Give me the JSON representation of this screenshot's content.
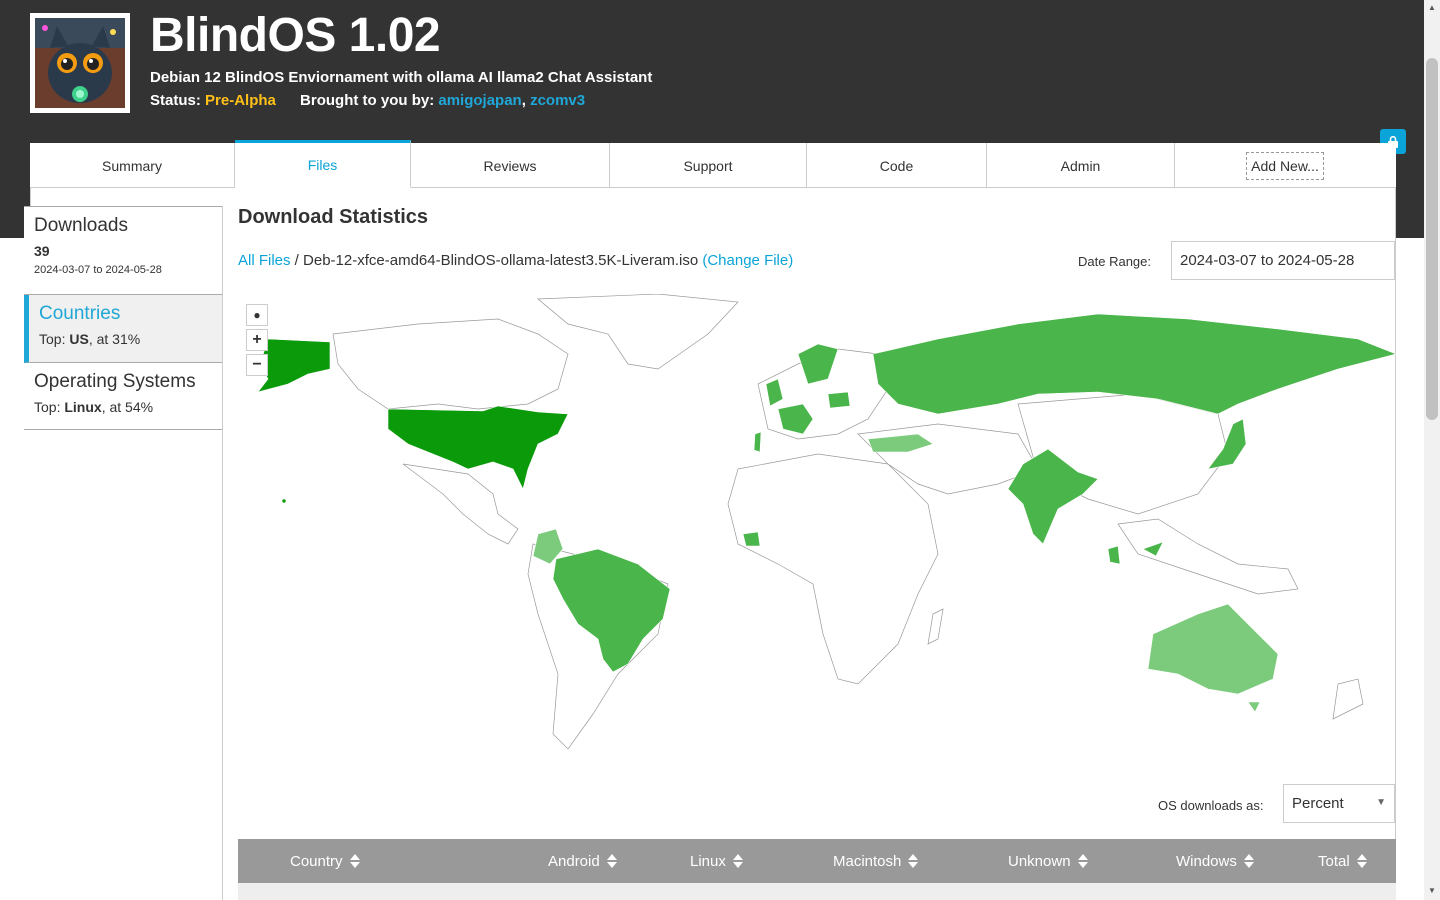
{
  "header": {
    "title": "BlindOS 1.02",
    "subtitle": "Debian 12 BlindOS Enviornament with ollama AI llama2 Chat Assistant",
    "status_label": "Status:",
    "status_value": "Pre-Alpha",
    "brought_label": "Brought to you by:",
    "authors": [
      "amigojapan",
      "zcomv3"
    ],
    "author_separator": ","
  },
  "tabs": [
    "Summary",
    "Files",
    "Reviews",
    "Support",
    "Code",
    "Admin",
    "Add New..."
  ],
  "active_tab": "Files",
  "sidebar": {
    "downloads": {
      "title": "Downloads",
      "count": "39",
      "range": "2024-03-07 to 2024-05-28"
    },
    "countries": {
      "title": "Countries",
      "top_label": "Top:",
      "top_value": "US",
      "top_suffix": ", at 31%"
    },
    "os": {
      "title": "Operating Systems",
      "top_label": "Top:",
      "top_value": "Linux",
      "top_suffix": ", at 54%"
    }
  },
  "main": {
    "heading": "Download Statistics",
    "all_files": "All Files",
    "separator": " / ",
    "filename": "Deb-12-xfce-amd64-BlindOS-ollama-latest3.5K-Liveram.iso",
    "change_file": "(Change File)",
    "date_range_label": "Date Range:",
    "date_range_value": "2024-03-07 to 2024-05-28",
    "os_downloads_label": "OS downloads as:",
    "os_downloads_value": "Percent",
    "map_controls": {
      "reset": "●",
      "zoom_in": "+",
      "zoom_out": "−"
    }
  },
  "table": {
    "columns": [
      "Country",
      "Android",
      "Linux",
      "Macintosh",
      "Unknown",
      "Windows",
      "Total"
    ]
  },
  "colors": {
    "header_bg": "#333333",
    "accent": "#0ba4d8",
    "status": "#fec018",
    "map_dark": "#0a9a0a",
    "map_mid": "#4ab54a",
    "map_light": "#7ccb7c"
  },
  "map_highlighted_regions": [
    "Alaska",
    "United States",
    "Russia",
    "India",
    "Brazil",
    "Colombia",
    "Australia",
    "Japan",
    "France",
    "United Kingdom",
    "Turkey",
    "Poland",
    "Sweden",
    "Malaysia",
    "Portugal",
    "Liberia",
    "Hawaii"
  ]
}
